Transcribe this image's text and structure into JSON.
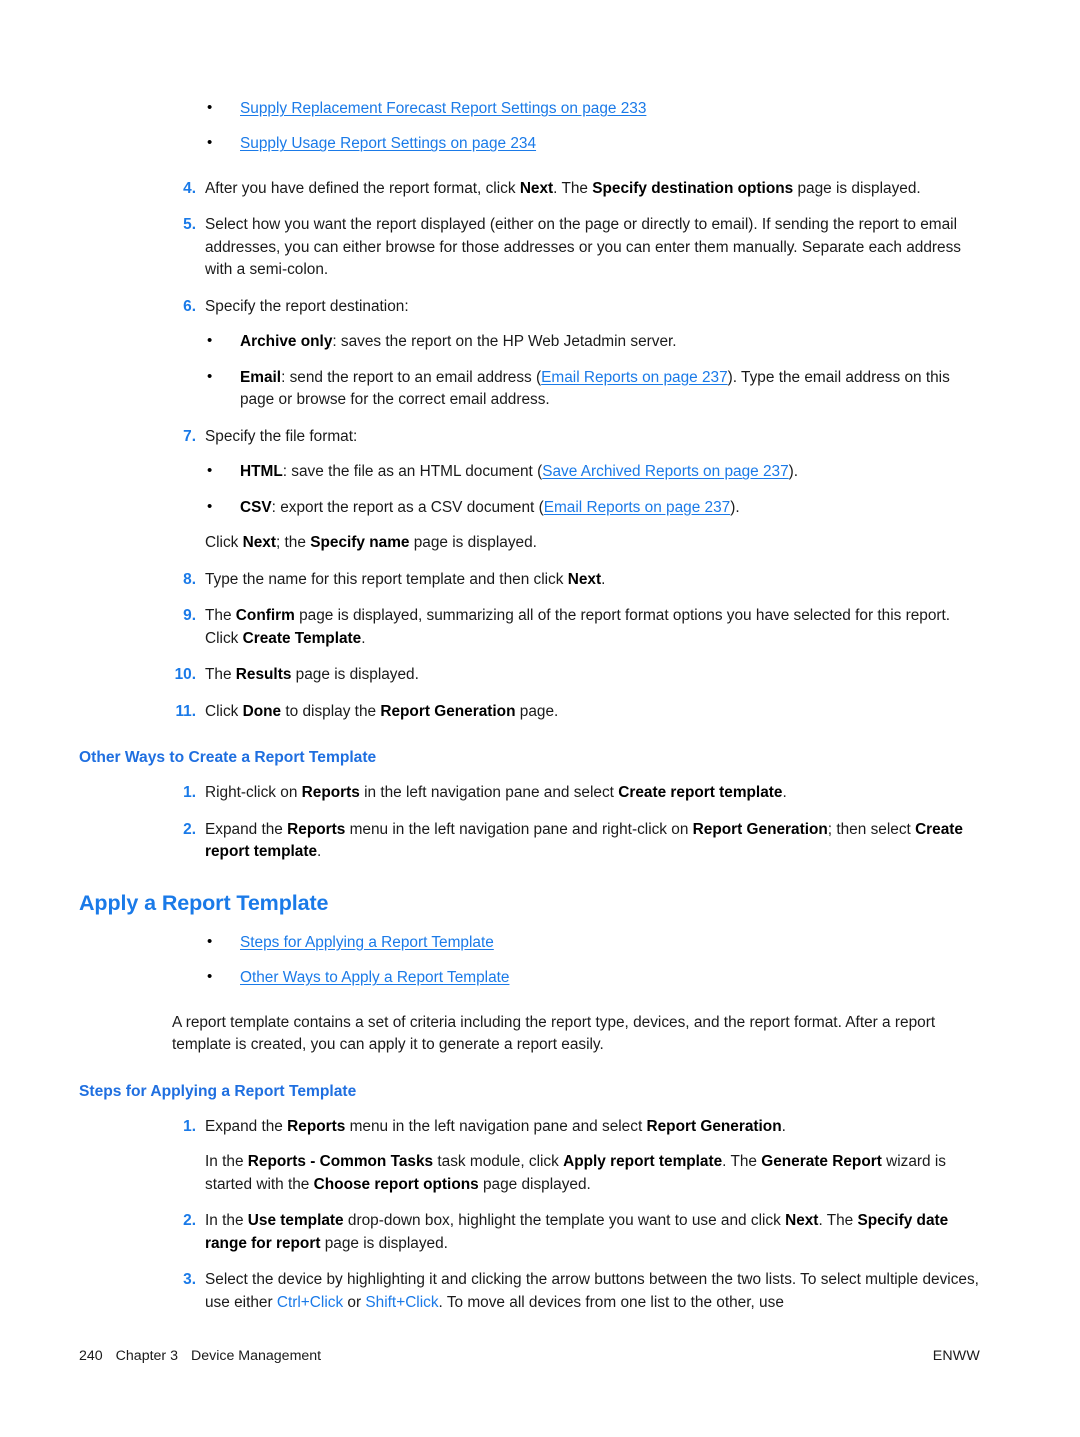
{
  "document": {
    "page_number": "240",
    "chapter": "Chapter 3",
    "chapter_title": "Device Management",
    "footer_right": "ENWW",
    "colors": {
      "link": "#1a7ae8",
      "heading_major": "#1a7ae8",
      "heading_minor": "#1f6fe0",
      "list_number": "#1a7ae8",
      "body": "#1a1a1a"
    }
  },
  "top_bullets": [
    {
      "text": "Supply Replacement Forecast Report Settings on page 233"
    },
    {
      "text": "Supply Usage Report Settings on page 234"
    }
  ],
  "steps_create": {
    "s4": {
      "num": "4.",
      "t1": "After you have defined the report format, click ",
      "b1": "Next",
      "t2": ". The ",
      "b2": "Specify destination options",
      "t3": " page is displayed."
    },
    "s5": {
      "num": "5.",
      "t1": "Select how you want the report displayed (either on the page or directly to email). If sending the report to email addresses, you can either browse for those addresses or you can enter them manually. Separate each address with a semi-colon."
    },
    "s6": {
      "num": "6.",
      "t1": "Specify the report destination:",
      "bullets": [
        {
          "b1": "Archive only",
          "t1": ": saves the report on the HP Web Jetadmin server."
        },
        {
          "b1": "Email",
          "t1": ": send the report to an email address (",
          "link": "Email Reports on page 237",
          "t2": "). Type the email address on this page or browse for the correct email address."
        }
      ]
    },
    "s7": {
      "num": "7.",
      "t1": "Specify the file format:",
      "bullets": [
        {
          "b1": "HTML",
          "t1": ": save the file as an HTML document (",
          "link": "Save Archived Reports on page 237",
          "t2": ")."
        },
        {
          "b1": "CSV",
          "t1": ": export the report as a CSV document (",
          "link": "Email Reports on page 237",
          "t2": ")."
        }
      ],
      "trailing": {
        "t1": "Click ",
        "b1": "Next",
        "t2": "; the ",
        "b2": "Specify name",
        "t3": " page is displayed."
      }
    },
    "s8": {
      "num": "8.",
      "t1": "Type the name for this report template and then click ",
      "b1": "Next",
      "t2": "."
    },
    "s9": {
      "num": "9.",
      "t1": "The ",
      "b1": "Confirm",
      "t2": " page is displayed, summarizing all of the report format options you have selected for this report. Click ",
      "b2": "Create Template",
      "t3": "."
    },
    "s10": {
      "num": "10.",
      "t1": "The ",
      "b1": "Results",
      "t2": " page is displayed."
    },
    "s11": {
      "num": "11.",
      "t1": "Click ",
      "b1": "Done",
      "t2": " to display the ",
      "b2": "Report Generation",
      "t3": " page."
    }
  },
  "other_ways_create": {
    "heading": "Other Ways to Create a Report Template",
    "s1": {
      "num": "1.",
      "t1": "Right-click on ",
      "b1": "Reports",
      "t2": " in the left navigation pane and select ",
      "b2": "Create report template",
      "t3": "."
    },
    "s2": {
      "num": "2.",
      "t1": "Expand the ",
      "b1": "Reports",
      "t2": " menu in the left navigation pane and right-click on ",
      "b2": "Report Generation",
      "t3": "; then select ",
      "b3": "Create report template",
      "t4": "."
    }
  },
  "apply_section": {
    "heading": "Apply a Report Template",
    "bullets": [
      {
        "text": "Steps for Applying a Report Template"
      },
      {
        "text": "Other Ways to Apply a Report Template"
      }
    ],
    "intro": "A report template contains a set of criteria including the report type, devices, and the report format. After a report template is created, you can apply it to generate a report easily."
  },
  "steps_apply": {
    "heading": "Steps for Applying a Report Template",
    "s1": {
      "num": "1.",
      "t1": "Expand the ",
      "b1": "Reports",
      "t2": " menu in the left navigation pane and select ",
      "b2": "Report Generation",
      "t3": ".",
      "sub": {
        "t1": "In the ",
        "b1": "Reports - Common Tasks",
        "t2": " task module, click ",
        "b2": "Apply report template",
        "t3": ". The ",
        "b3": "Generate Report",
        "t4": " wizard is started with the ",
        "b4": "Choose report options",
        "t5": " page displayed."
      }
    },
    "s2": {
      "num": "2.",
      "t1": "In the ",
      "b1": "Use template",
      "t2": " drop-down box, highlight the template you want to use and click ",
      "b2": "Next",
      "t3": ". The ",
      "b3": "Specify date range for report",
      "t4": " page is displayed."
    },
    "s3": {
      "num": "3.",
      "t1": "Select the device by highlighting it and clicking the arrow buttons between the two lists. To select multiple devices, use either ",
      "k1": "Ctrl+Click",
      "t2": " or ",
      "k2": "Shift+Click",
      "t3": ". To move all devices from one list to the other, use"
    }
  }
}
